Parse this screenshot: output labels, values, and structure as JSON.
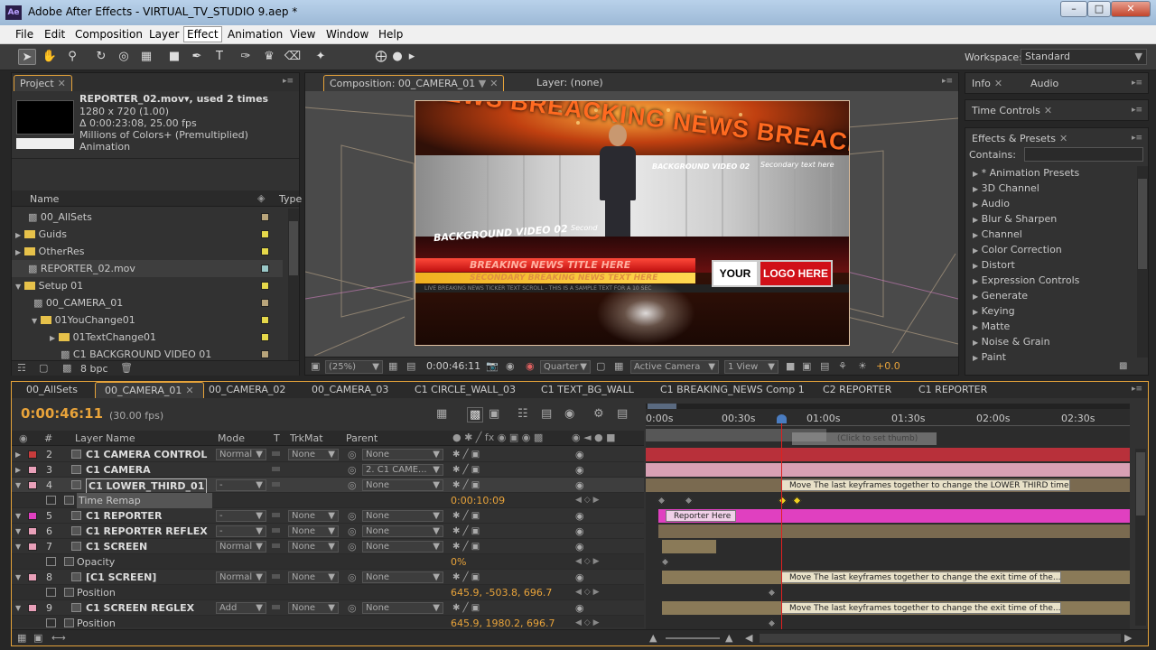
{
  "window": {
    "title": "Adobe After Effects - VIRTUAL_TV_STUDIO 9.aep *",
    "app_icon": "Ae"
  },
  "menu": [
    "File",
    "Edit",
    "Composition",
    "Layer",
    "Effect",
    "Animation",
    "View",
    "Window",
    "Help"
  ],
  "toolbar": {
    "workspace_label": "Workspace:",
    "workspace_value": "Standard"
  },
  "project": {
    "tab": "Project",
    "footage_name": "REPORTER_02.mov▾, used 2 times",
    "footage_size": "1280 x 720 (1.00)",
    "footage_duration": "Δ 0:00:23:08, 25.00 fps",
    "footage_colors": "Millions of Colors+ (Premultiplied)",
    "footage_codec": "Animation",
    "col_name": "Name",
    "col_type": "Type",
    "items": [
      {
        "name": "00_AllSets"
      },
      {
        "name": "Guids"
      },
      {
        "name": "OtherRes"
      },
      {
        "name": "REPORTER_02.mov"
      },
      {
        "name": "Setup 01"
      },
      {
        "name": "00_CAMERA_01"
      },
      {
        "name": "01YouChange01"
      },
      {
        "name": "01TextChange01"
      },
      {
        "name": "C1 BACKGROUND VIDEO 01"
      }
    ],
    "bpc": "8 bpc"
  },
  "comp_viewer": {
    "tab": "Composition: 00_CAMERA_01",
    "layer_tab": "Layer: (none)",
    "zoom": "(25%)",
    "timecode": "0:00:46:11",
    "resolution": "Quarter",
    "camera": "Active Camera",
    "view": "1 View",
    "exposure": "+0.0",
    "scene": {
      "news_banner": "NEWS BREACKING NEWS BREACKI",
      "bg_video_02": "BACKGROUND VIDEO 02",
      "secondary_text_small": "Secondary text here",
      "bg_video_02_b": "BACKGROUND VIDEO 02",
      "second_small": "Second",
      "breaking_headline": "BREAKING NEWS TITLE HERE",
      "secondary_breaking": "SECONDARY BREAKING NEWS TEXT HERE",
      "ticker": "LIVE BREAKING NEWS TICKER TEXT SCROLL - THIS IS A SAMPLE TEXT FOR A 10 SEC",
      "logo_your": "YOUR",
      "logo_here": "LOGO HERE"
    }
  },
  "right_panels": {
    "info_tab": "Info",
    "audio_tab": "Audio",
    "time_controls_tab": "Time Controls",
    "effects_tab": "Effects & Presets",
    "contains_label": "Contains:",
    "effects": [
      "* Animation Presets",
      "3D Channel",
      "Audio",
      "Blur & Sharpen",
      "Channel",
      "Color Correction",
      "Distort",
      "Expression Controls",
      "Generate",
      "Keying",
      "Matte",
      "Noise & Grain",
      "Paint"
    ]
  },
  "timeline": {
    "comp_tabs": [
      "00_AllSets",
      "00_CAMERA_01",
      "00_CAMERA_02",
      "00_CAMERA_03",
      "C1 CIRCLE_WALL_03",
      "C1 TEXT_BG_WALL",
      "C1 BREAKING_NEWS Comp 1",
      "C2 REPORTER",
      "C1 REPORTER"
    ],
    "timecode": "0:00:46:11",
    "fps": "(30.00 fps)",
    "headers": {
      "hash": "#",
      "layer_name": "Layer Name",
      "mode": "Mode",
      "t": "T",
      "trkmat": "TrkMat",
      "parent": "Parent"
    },
    "ruler": [
      "0:00s",
      "00:30s",
      "01:00s",
      "01:30s",
      "02:00s",
      "02:30s"
    ],
    "ghost_hint": "(Click to set thumb)",
    "rows": [
      {
        "num": "2",
        "name": "C1 CAMERA CONTROL",
        "mode": "Normal",
        "trkmat": "None",
        "parent": "None",
        "color": "#c83c3c",
        "type": "layer"
      },
      {
        "num": "3",
        "name": "C1 CAMERA",
        "mode": "",
        "trkmat": "",
        "parent": "2. C1 CAME...",
        "color": "#e9a0b9",
        "type": "layer"
      },
      {
        "num": "4",
        "name": "C1 LOWER_THIRD_01",
        "mode": "-",
        "trkmat": "",
        "parent": "None",
        "color": "#e9a0b9",
        "type": "layer"
      },
      {
        "num": "",
        "name": "Time Remap",
        "value": "0:00:10:09",
        "type": "prop"
      },
      {
        "num": "5",
        "name": "C1 REPORTER",
        "mode": "-",
        "trkmat": "None",
        "parent": "None",
        "color": "#e040c0",
        "type": "layer"
      },
      {
        "num": "6",
        "name": "C1 REPORTER REFLEX",
        "mode": "-",
        "trkmat": "None",
        "parent": "None",
        "color": "#e9a0b9",
        "type": "layer"
      },
      {
        "num": "7",
        "name": "C1 SCREEN",
        "mode": "Normal",
        "trkmat": "None",
        "parent": "None",
        "color": "#e9a0b9",
        "type": "layer"
      },
      {
        "num": "",
        "name": "Opacity",
        "value": "0%",
        "type": "prop"
      },
      {
        "num": "8",
        "name": "[C1 SCREEN]",
        "mode": "Normal",
        "trkmat": "None",
        "parent": "None",
        "color": "#e9a0b9",
        "type": "layer"
      },
      {
        "num": "",
        "name": "Position",
        "value": "645.9, -503.8, 696.7",
        "type": "prop"
      },
      {
        "num": "9",
        "name": "C1 SCREEN REGLEX",
        "mode": "Add",
        "trkmat": "None",
        "parent": "None",
        "color": "#e9a0b9",
        "type": "layer"
      },
      {
        "num": "",
        "name": "Position",
        "value": "645.9, 1980.2, 696.7",
        "type": "prop"
      }
    ],
    "notes": {
      "lower_third": "Move The last keyframes together to change the LOWER THIRD time...",
      "reporter": "Reporter Here",
      "exit_time_1": "Move The last keyframes together to change the exit time of the...",
      "exit_time_2": "Move The last keyframes together to change the exit time of the..."
    }
  }
}
